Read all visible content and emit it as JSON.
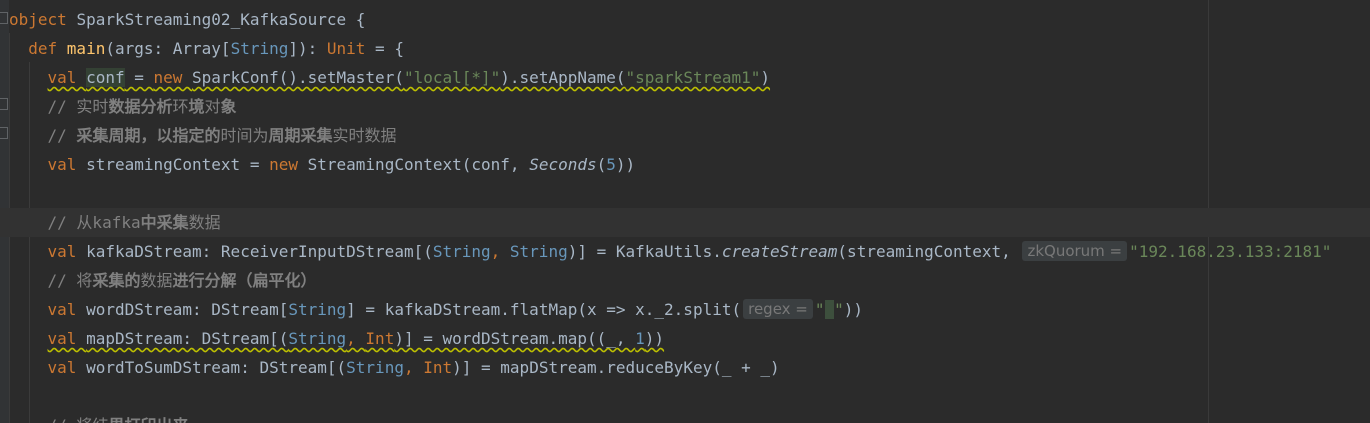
{
  "lines": [
    {
      "id": "object_decl",
      "parts": [
        {
          "t": "object ",
          "c": "kw"
        },
        {
          "t": "SparkStreaming02_KafkaSource {",
          "c": ""
        }
      ]
    },
    {
      "id": "main_def",
      "parts": [
        {
          "t": "  def ",
          "c": "kw"
        },
        {
          "t": "main",
          "c": "fn"
        },
        {
          "t": "(args: Array[",
          "c": ""
        },
        {
          "t": "String",
          "c": "ty"
        },
        {
          "t": "]): ",
          "c": ""
        },
        {
          "t": "Unit",
          "c": "kw"
        },
        {
          "t": " = {",
          "c": ""
        }
      ]
    },
    {
      "id": "conf_val",
      "parts": [
        {
          "t": "    ",
          "c": ""
        },
        {
          "t": "val ",
          "c": "kw wavy"
        },
        {
          "t": "conf",
          "c": "hl wavy"
        },
        {
          "t": " = ",
          "c": "wavy"
        },
        {
          "t": "new ",
          "c": "kw wavy"
        },
        {
          "t": "SparkConf().setMaster(",
          "c": "wavy"
        },
        {
          "t": "\"local[*]\"",
          "c": "str wavy"
        },
        {
          "t": ").setAppName(",
          "c": "wavy"
        },
        {
          "t": "\"sparkStream1\"",
          "c": "str wavy"
        },
        {
          "t": ")",
          "c": "wavy"
        }
      ]
    },
    {
      "id": "comment_1",
      "parts": [
        {
          "t": "    // 实时",
          "c": "cm"
        },
        {
          "t": "数据分析",
          "c": "cmb"
        },
        {
          "t": "环",
          "c": "cm"
        },
        {
          "t": "境",
          "c": "cmb"
        },
        {
          "t": "对",
          "c": "cm"
        },
        {
          "t": "象",
          "c": "cmb"
        }
      ]
    },
    {
      "id": "comment_2",
      "parts": [
        {
          "t": "    // ",
          "c": "cm"
        },
        {
          "t": "采集周期，以指定的",
          "c": "cmb"
        },
        {
          "t": "时间为",
          "c": "cm"
        },
        {
          "t": "周期采集",
          "c": "cmb"
        },
        {
          "t": "实时数据",
          "c": "cm"
        }
      ]
    },
    {
      "id": "ssc_val",
      "parts": [
        {
          "t": "    ",
          "c": ""
        },
        {
          "t": "val ",
          "c": "kw"
        },
        {
          "t": "streamingContext = ",
          "c": ""
        },
        {
          "t": "new ",
          "c": "kw"
        },
        {
          "t": "StreamingContext(conf, ",
          "c": ""
        },
        {
          "t": "Seconds",
          "c": "it"
        },
        {
          "t": "(",
          "c": ""
        },
        {
          "t": "5",
          "c": "num"
        },
        {
          "t": "))",
          "c": ""
        }
      ]
    },
    {
      "id": "blank_1",
      "parts": []
    },
    {
      "id": "comment_3",
      "current": true,
      "parts": [
        {
          "t": "    // 从kafka",
          "c": "cm"
        },
        {
          "t": "中采集",
          "c": "cmb"
        },
        {
          "t": "数据",
          "c": "cm"
        }
      ]
    },
    {
      "id": "kafka_val",
      "parts": [
        {
          "t": "    ",
          "c": ""
        },
        {
          "t": "val ",
          "c": "kw"
        },
        {
          "t": "kafkaDStream: ReceiverInputDStream[(",
          "c": ""
        },
        {
          "t": "String",
          "c": "ty"
        },
        {
          "t": ", ",
          "c": "kw"
        },
        {
          "t": "String",
          "c": "ty"
        },
        {
          "t": ")] = KafkaUtils.",
          "c": ""
        },
        {
          "t": "createStream",
          "c": "it"
        },
        {
          "t": "(streamingContext, ",
          "c": ""
        },
        {
          "t": "zkQuorum =",
          "hint": true
        },
        {
          "t": "\"192.168.23.133:2181\"",
          "c": "str"
        }
      ]
    },
    {
      "id": "comment_4",
      "parts": [
        {
          "t": "    // 将",
          "c": "cm"
        },
        {
          "t": "采集的",
          "c": "cmb"
        },
        {
          "t": "数据",
          "c": "cm"
        },
        {
          "t": "进行分解（扁平化）",
          "c": "cmb"
        }
      ]
    },
    {
      "id": "word_val",
      "parts": [
        {
          "t": "    ",
          "c": ""
        },
        {
          "t": "val ",
          "c": "kw"
        },
        {
          "t": "wordDStream: DStream[",
          "c": ""
        },
        {
          "t": "String",
          "c": "ty"
        },
        {
          "t": "] = kafkaDStream.flatMap(x => x._2.split(",
          "c": ""
        },
        {
          "t": "regex =",
          "hint": true
        },
        {
          "t": "\"",
          "c": "str"
        },
        {
          "t": " ",
          "c": "str caret-box"
        },
        {
          "t": "\"",
          "c": "str"
        },
        {
          "t": "))",
          "c": ""
        }
      ]
    },
    {
      "id": "map_val",
      "parts": [
        {
          "t": "    ",
          "c": ""
        },
        {
          "t": "val ",
          "c": "kw wavy"
        },
        {
          "t": "mapDStream: DStream[(",
          "c": "wavy"
        },
        {
          "t": "String",
          "c": "ty wavy"
        },
        {
          "t": ", ",
          "c": "kw wavy"
        },
        {
          "t": "Int",
          "c": "kw wavy"
        },
        {
          "t": ")] = wordDStream.map((_, ",
          "c": "wavy"
        },
        {
          "t": "1",
          "c": "num wavy"
        },
        {
          "t": "))",
          "c": "wavy"
        }
      ]
    },
    {
      "id": "sum_val",
      "parts": [
        {
          "t": "    ",
          "c": ""
        },
        {
          "t": "val ",
          "c": "kw"
        },
        {
          "t": "wordToSumDStream: DStream[(",
          "c": ""
        },
        {
          "t": "String",
          "c": "ty"
        },
        {
          "t": ", ",
          "c": "kw"
        },
        {
          "t": "Int",
          "c": "kw"
        },
        {
          "t": ")] = mapDStream.reduceByKey(_ + _)",
          "c": ""
        }
      ]
    },
    {
      "id": "blank_2",
      "parts": []
    },
    {
      "id": "comment_5",
      "parts": [
        {
          "t": "    // 将结",
          "c": "cm"
        },
        {
          "t": "果打印出来",
          "c": "cmb"
        }
      ]
    }
  ]
}
